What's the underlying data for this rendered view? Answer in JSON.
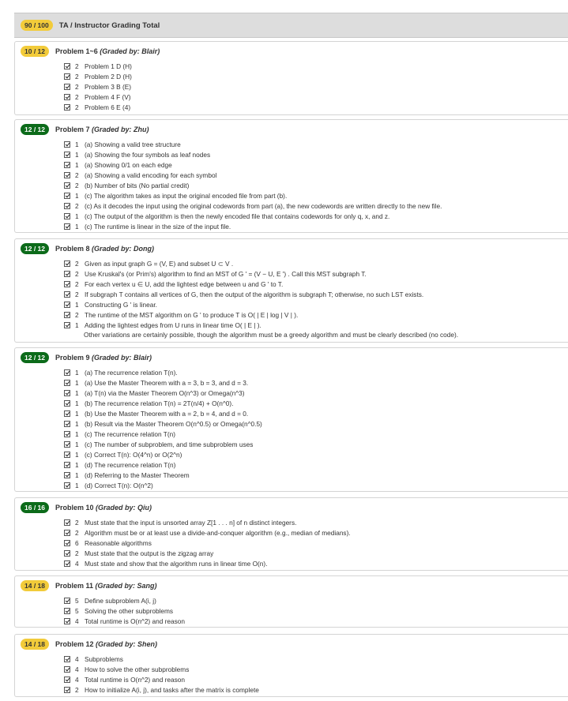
{
  "header": {
    "score": "90 / 100",
    "title": "TA / Instructor Grading Total"
  },
  "sections": [
    {
      "score": "10 / 12",
      "badge_color": "#f2cb3a",
      "title": "Problem 1~6",
      "grader": "(Graded by: Blair)",
      "items": [
        {
          "pts": "2",
          "text": "Problem 1 D (H)"
        },
        {
          "pts": "2",
          "text": "Problem 2 D (H)"
        },
        {
          "pts": "2",
          "text": "Problem 3 B (E)"
        },
        {
          "pts": "2",
          "text": "Problem 4 F (V)"
        },
        {
          "pts": "2",
          "text": "Problem 6 E (4)"
        }
      ]
    },
    {
      "score": "12 / 12",
      "badge_color": "#0c6b1a",
      "title": "Problem 7",
      "grader": "(Graded by: Zhu)",
      "items": [
        {
          "pts": "1",
          "text": "(a) Showing a valid tree structure"
        },
        {
          "pts": "1",
          "text": "(a) Showing the four symbols as leaf nodes"
        },
        {
          "pts": "1",
          "text": "(a) Showing 0/1 on each edge"
        },
        {
          "pts": "2",
          "text": "(a) Showing a valid encoding for each symbol"
        },
        {
          "pts": "2",
          "text": "(b) Number of bits (No partial credit)"
        },
        {
          "pts": "1",
          "text": "(c) The algorithm takes as input the original encoded file from part (b)."
        },
        {
          "pts": "2",
          "text": "(c) As it decodes the input using the original codewords from part (a), the new codewords are written directly to the new file."
        },
        {
          "pts": "1",
          "text": "(c) The output of the algorithm is then the newly encoded file that contains codewords for only q, x, and z."
        },
        {
          "pts": "1",
          "text": "(c) The runtime is linear in the size of the input file."
        }
      ]
    },
    {
      "score": "12 / 12",
      "badge_color": "#0c6b1a",
      "title": "Problem 8",
      "grader": "(Graded by: Dong)",
      "items": [
        {
          "pts": "2",
          "text": "Given as input graph G = (V, E) and subset U ⊂ V ."
        },
        {
          "pts": "2",
          "text": "Use Kruskal's (or Prim's) algorithm to find an MST of G ' = (V − U, E ') . Call this MST subgraph T."
        },
        {
          "pts": "2",
          "text": "For each vertex u ∈ U, add the lightest edge between u and G ' to T."
        },
        {
          "pts": "2",
          "text": "If subgraph T contains all vertices of G, then the output of the algorithm is subgraph T; otherwise, no such LST exists."
        },
        {
          "pts": "1",
          "text": "Constructing G ' is linear."
        },
        {
          "pts": "2",
          "text": "The runtime of the MST algorithm on G ' to produce T is O( | E | log | V | )."
        },
        {
          "pts": "1",
          "text": "Adding the lightest edges from U runs in linear time O( | E | )."
        }
      ],
      "note": "Other variations are certainly possible, though the algorithm must be a greedy algorithm and must be clearly described (no code)."
    },
    {
      "score": "12 / 12",
      "badge_color": "#0c6b1a",
      "title": "Problem 9",
      "grader": "(Graded by: Blair)",
      "items": [
        {
          "pts": "1",
          "text": "(a) The recurrence relation T(n)."
        },
        {
          "pts": "1",
          "text": "(a) Use the Master Theorem with a = 3, b = 3, and d = 3."
        },
        {
          "pts": "1",
          "text": "(a) T(n) via the Master Theorem O(n^3) or Omega(n^3)"
        },
        {
          "pts": "1",
          "text": "(b) The recurrence relation T(n) = 2T(n/4) + O(n^0)."
        },
        {
          "pts": "1",
          "text": "(b) Use the Master Theorem with a = 2, b = 4, and d = 0."
        },
        {
          "pts": "1",
          "text": "(b) Result via the Master Theorem O(n^0.5) or Omega(n^0.5)"
        },
        {
          "pts": "1",
          "text": "(c) The recurrence relation T(n)"
        },
        {
          "pts": "1",
          "text": "(c) The number of subproblem, and time subproblem uses"
        },
        {
          "pts": "1",
          "text": "(c) Correct T(n): O(4^n) or O(2^n)"
        },
        {
          "pts": "1",
          "text": "(d) The recurrence relation T(n)"
        },
        {
          "pts": "1",
          "text": "(d) Referring to the Master Theorem"
        },
        {
          "pts": "1",
          "text": "(d) Correct T(n): O(n^2)"
        }
      ]
    },
    {
      "score": "16 / 16",
      "badge_color": "#0c6b1a",
      "title": "Problem 10",
      "grader": "(Graded by: Qiu)",
      "items": [
        {
          "pts": "2",
          "text": "Must state that the input is unsorted array Z[1 . . . n] of n distinct integers."
        },
        {
          "pts": "2",
          "text": "Algorithm must be or at least use a divide-and-conquer algorithm (e.g., median of medians)."
        },
        {
          "pts": "6",
          "text": "Reasonable algorithms"
        },
        {
          "pts": "2",
          "text": "Must state that the output is the zigzag array"
        },
        {
          "pts": "4",
          "text": "Must state and show that the algorithm runs in linear time O(n)."
        }
      ]
    },
    {
      "score": "14 / 18",
      "badge_color": "#f2cb3a",
      "title": "Problem 11",
      "grader": "(Graded by: Sang)",
      "items": [
        {
          "pts": "5",
          "text": "Define subproblem A(i, j)"
        },
        {
          "pts": "5",
          "text": "Solving the other subproblems"
        },
        {
          "pts": "4",
          "text": "Total runtime is O(n^2) and reason"
        }
      ]
    },
    {
      "score": "14 / 18",
      "badge_color": "#f2cb3a",
      "title": "Problem 12",
      "grader": "(Graded by: Shen)",
      "items": [
        {
          "pts": "4",
          "text": "Subproblems"
        },
        {
          "pts": "4",
          "text": "How to solve the other subproblems"
        },
        {
          "pts": "4",
          "text": "Total runtime is O(n^2) and reason"
        },
        {
          "pts": "2",
          "text": "How to initialize A(i, j), and tasks after the matrix is complete"
        }
      ]
    }
  ]
}
